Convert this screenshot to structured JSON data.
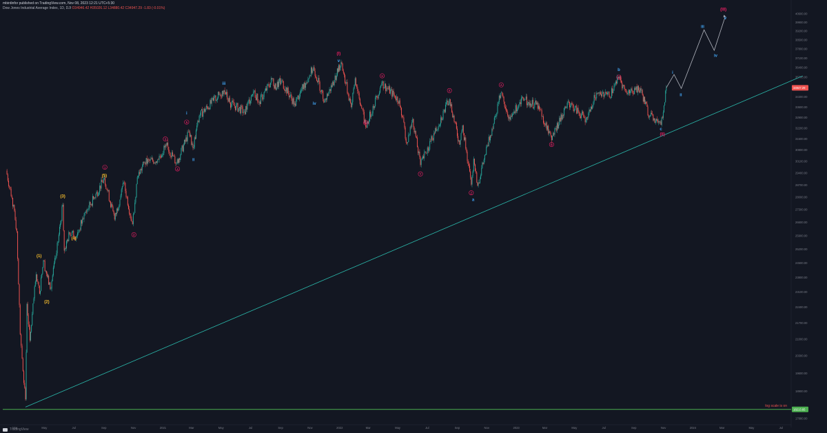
{
  "header": {
    "published": "mbirdinfor published on TradingView.com, Nov 08, 2023 12:21 UTC+5:30",
    "symbol": "Dow Jones Industrial Average Index, 1D, DJI",
    "ohlc": "O34946.42 H35026.12 L34880.42 C34947.29 -1.83 (-0.01%)"
  },
  "footer": {
    "brand": "TradingView"
  },
  "colors": {
    "background": "#131722",
    "up": "#26a69a",
    "down": "#ef5350",
    "trendline": "#2bbbad",
    "support": "#4caf50",
    "label_primary": "#e91e63",
    "label_yellow": "#fbc02d",
    "label_blue": "#42a5f5",
    "projection": "#b2b5be"
  },
  "chart_data": {
    "type": "line",
    "yscale": "log",
    "ylim": [
      17880,
      40600
    ],
    "current_price_label": "34947.29",
    "support_label": "18213.65",
    "log_note": "log scale is on",
    "x_ticks": [
      "Mar",
      "May",
      "Jul",
      "Sep",
      "Nov",
      "2021",
      "Mar",
      "May",
      "Jul",
      "Sep",
      "Nov",
      "2022",
      "Mar",
      "May",
      "Jul",
      "Sep",
      "Nov",
      "2023",
      "Mar",
      "May",
      "Jul",
      "Sep",
      "Nov",
      "2024",
      "Mar",
      "May",
      "Jul"
    ],
    "y_ticks": [
      "40600.00",
      "39900.00",
      "39200.00",
      "38500.00",
      "37800.00",
      "37100.00",
      "36400.00",
      "35700.00",
      "35000.00",
      "34300.00",
      "33600.00",
      "32900.00",
      "32200.00",
      "31500.00",
      "30800.00",
      "30100.00",
      "29400.00",
      "28700.00",
      "28000.00",
      "27300.00",
      "26600.00",
      "25900.00",
      "25200.00",
      "24500.00",
      "23800.00",
      "23100.00",
      "22400.00",
      "21700.00",
      "21000.00",
      "20300.00",
      "19600.00",
      "18900.00",
      "18200.00",
      "17880.00"
    ],
    "series": [
      {
        "values": [
          [
            "2020-02-12",
            29551
          ],
          [
            "2020-02-24",
            27960
          ],
          [
            "2020-03-05",
            26121
          ],
          [
            "2020-03-12",
            21200
          ],
          [
            "2020-03-16",
            20188
          ],
          [
            "2020-03-23",
            18591
          ],
          [
            "2020-03-26",
            22552
          ],
          [
            "2020-04-01",
            20943
          ],
          [
            "2020-04-14",
            23949
          ],
          [
            "2020-04-21",
            23018
          ],
          [
            "2020-04-29",
            24633
          ],
          [
            "2020-05-13",
            23247
          ],
          [
            "2020-05-26",
            24995
          ],
          [
            "2020-06-08",
            27572
          ],
          [
            "2020-06-11",
            25128
          ],
          [
            "2020-06-22",
            26024
          ],
          [
            "2020-07-07",
            25890
          ],
          [
            "2020-07-22",
            27005
          ],
          [
            "2020-08-12",
            27976
          ],
          [
            "2020-09-02",
            29100
          ],
          [
            "2020-09-23",
            26763
          ],
          [
            "2020-10-12",
            28837
          ],
          [
            "2020-10-30",
            26501
          ],
          [
            "2020-11-09",
            29158
          ],
          [
            "2020-11-24",
            30046
          ],
          [
            "2020-12-21",
            30216
          ],
          [
            "2021-01-08",
            31097
          ],
          [
            "2021-01-29",
            29983
          ],
          [
            "2021-02-24",
            31961
          ],
          [
            "2021-03-04",
            30924
          ],
          [
            "2021-03-17",
            33015
          ],
          [
            "2021-04-15",
            34035
          ],
          [
            "2021-05-07",
            34777
          ],
          [
            "2021-05-19",
            33896
          ],
          [
            "2021-06-18",
            33290
          ],
          [
            "2021-07-07",
            34681
          ],
          [
            "2021-07-19",
            33962
          ],
          [
            "2021-08-16",
            35625
          ],
          [
            "2021-08-19",
            34893
          ],
          [
            "2021-09-02",
            35443
          ],
          [
            "2021-09-30",
            33844
          ],
          [
            "2021-11-08",
            36432
          ],
          [
            "2021-12-01",
            34022
          ],
          [
            "2021-12-21",
            35492
          ],
          [
            "2022-01-04",
            36800
          ],
          [
            "2022-01-25",
            33600
          ],
          [
            "2022-02-02",
            35630
          ],
          [
            "2022-02-24",
            32272
          ],
          [
            "2022-03-29",
            35294
          ],
          [
            "2022-05-04",
            34061
          ],
          [
            "2022-05-20",
            31253
          ],
          [
            "2022-06-01",
            32813
          ],
          [
            "2022-06-17",
            29888
          ],
          [
            "2022-07-08",
            31338
          ],
          [
            "2022-08-16",
            34152
          ],
          [
            "2022-09-06",
            31145
          ],
          [
            "2022-09-12",
            32381
          ],
          [
            "2022-09-30",
            28725
          ],
          [
            "2022-10-05",
            30273
          ],
          [
            "2022-10-13",
            28660
          ],
          [
            "2022-11-30",
            34589
          ],
          [
            "2022-12-19",
            32757
          ],
          [
            "2023-01-13",
            34302
          ],
          [
            "2023-01-26",
            33949
          ],
          [
            "2023-02-16",
            33696
          ],
          [
            "2023-03-15",
            31429
          ],
          [
            "2023-04-18",
            33976
          ],
          [
            "2023-05-25",
            32764
          ],
          [
            "2023-06-16",
            34588
          ],
          [
            "2023-07-12",
            34347
          ],
          [
            "2023-08-01",
            35630
          ],
          [
            "2023-08-18",
            34500
          ],
          [
            "2023-09-14",
            34907
          ],
          [
            "2023-10-03",
            33002
          ],
          [
            "2023-10-27",
            32417
          ],
          [
            "2023-11-07",
            34947
          ]
        ]
      }
    ],
    "projection": [
      [
        "2023-11-07",
        34947
      ],
      [
        "2023-11-23",
        35900
      ],
      [
        "2023-12-08",
        34900
      ],
      [
        "2024-01-24",
        39300
      ],
      [
        "2024-02-14",
        37700
      ],
      [
        "2024-03-08",
        40400
      ]
    ],
    "trendline": [
      [
        "2020-03-23",
        18300
      ],
      [
        "2024-08-15",
        35800
      ]
    ],
    "support_line": 18213.65,
    "wave_labels": [
      {
        "text": "(1)",
        "date": "2020-04-20",
        "price": 24850,
        "color": "yellow"
      },
      {
        "text": "(2)",
        "date": "2020-05-06",
        "price": 22650,
        "color": "yellow"
      },
      {
        "text": "(3)",
        "date": "2020-06-08",
        "price": 28050,
        "color": "yellow"
      },
      {
        "text": "(4)",
        "date": "2020-07-01",
        "price": 25750,
        "color": "yellow"
      },
      {
        "text": "(5)",
        "date": "2020-09-02",
        "price": 29250,
        "color": "yellow"
      },
      {
        "text": "1",
        "date": "2020-09-03",
        "price": 29750,
        "color": "primary",
        "circle": true
      },
      {
        "text": "2",
        "date": "2020-11-02",
        "price": 25950,
        "color": "primary",
        "circle": true
      },
      {
        "text": "3",
        "date": "2021-01-06",
        "price": 31500,
        "color": "primary",
        "circle": true
      },
      {
        "text": "4",
        "date": "2021-01-31",
        "price": 29650,
        "color": "primary",
        "circle": true
      },
      {
        "text": "5",
        "date": "2021-02-19",
        "price": 32600,
        "color": "primary",
        "circle": true
      },
      {
        "text": "i",
        "date": "2021-02-19",
        "price": 33200,
        "color": "blue"
      },
      {
        "text": "ii",
        "date": "2021-03-05",
        "price": 30200,
        "color": "blue"
      },
      {
        "text": "iii",
        "date": "2021-05-07",
        "price": 35250,
        "color": "blue"
      },
      {
        "text": "iv",
        "date": "2021-11-10",
        "price": 33850,
        "color": "blue"
      },
      {
        "text": "v",
        "date": "2021-12-30",
        "price": 36900,
        "color": "blue"
      },
      {
        "text": "(I)",
        "date": "2021-12-30",
        "price": 37450,
        "color": "primary"
      },
      {
        "text": "W",
        "date": "2022-02-24",
        "price": 32550,
        "color": "primary",
        "circle": true
      },
      {
        "text": "X",
        "date": "2022-03-30",
        "price": 35800,
        "color": "primary",
        "circle": true
      },
      {
        "text": "Y",
        "date": "2022-06-17",
        "price": 29350,
        "color": "primary",
        "circle": true
      },
      {
        "text": "X",
        "date": "2022-08-16",
        "price": 34750,
        "color": "primary",
        "circle": true
      },
      {
        "text": "Z",
        "date": "2022-09-30",
        "price": 28250,
        "color": "primary",
        "circle": true
      },
      {
        "text": "a",
        "date": "2022-10-04",
        "price": 27850,
        "color": "blue"
      },
      {
        "text": "A",
        "date": "2022-12-01",
        "price": 35150,
        "color": "primary",
        "circle": true
      },
      {
        "text": "B",
        "date": "2023-03-15",
        "price": 31150,
        "color": "primary",
        "circle": true
      },
      {
        "text": "C",
        "date": "2023-08-01",
        "price": 35700,
        "color": "primary",
        "circle": true
      },
      {
        "text": "b",
        "date": "2023-08-01",
        "price": 36250,
        "color": "blue"
      },
      {
        "text": "c",
        "date": "2023-10-27",
        "price": 32150,
        "color": "blue"
      },
      {
        "text": "(II)",
        "date": "2023-10-30",
        "price": 31800,
        "color": "primary"
      },
      {
        "text": "i",
        "date": "2023-11-20",
        "price": 36050,
        "color": "blue"
      },
      {
        "text": "ii",
        "date": "2023-12-07",
        "price": 34450,
        "color": "blue"
      },
      {
        "text": "iii",
        "date": "2024-01-21",
        "price": 39550,
        "color": "blue"
      },
      {
        "text": "iv",
        "date": "2024-02-17",
        "price": 37300,
        "color": "blue"
      },
      {
        "text": "v",
        "date": "2024-03-08",
        "price": 40250,
        "color": "blue"
      },
      {
        "text": "(III)",
        "date": "2024-03-04",
        "price": 40950,
        "color": "primary"
      }
    ]
  }
}
